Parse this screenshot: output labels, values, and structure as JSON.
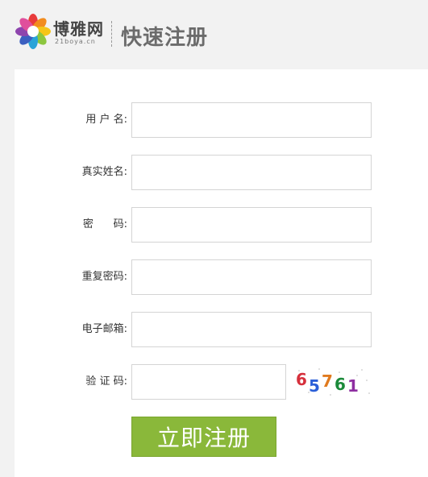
{
  "header": {
    "logo_name": "博雅网",
    "logo_domain": "21boya.cn",
    "page_title": "快速注册"
  },
  "form": {
    "fields": [
      {
        "label": "用 户 名:",
        "value": ""
      },
      {
        "label": "真实姓名:",
        "value": ""
      },
      {
        "label": "密      码:",
        "value": ""
      },
      {
        "label": "重复密码:",
        "value": ""
      },
      {
        "label": "电子邮箱:",
        "value": ""
      },
      {
        "label": "验 证 码:",
        "value": ""
      }
    ],
    "captcha_text": "65761",
    "submit_label": "立即注册"
  },
  "colors": {
    "submit_bg": "#8ab83a",
    "title_text": "#6b6b6b"
  }
}
